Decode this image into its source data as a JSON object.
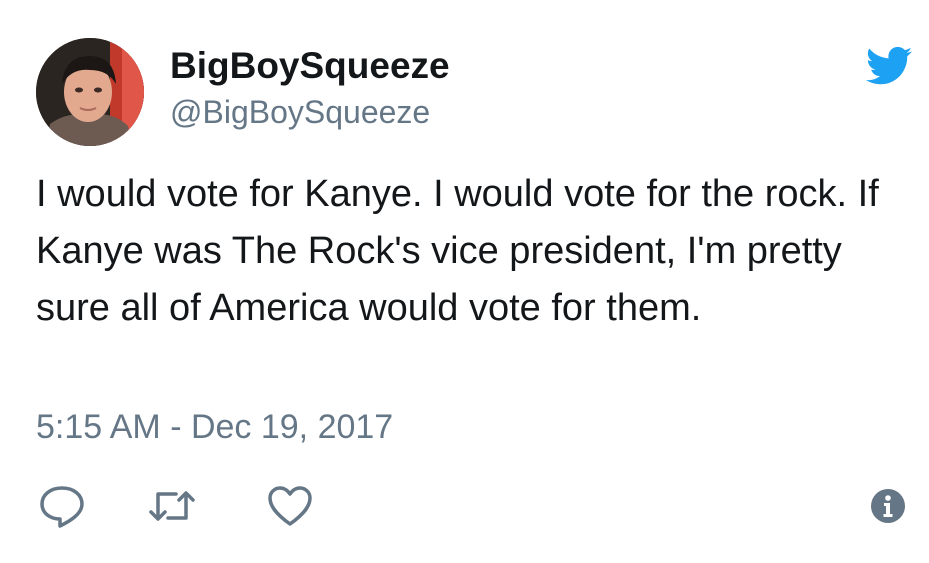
{
  "user": {
    "display_name": "BigBoySqueeze",
    "handle": "@BigBoySqueeze",
    "avatar_icon": "profile-photo"
  },
  "brand": {
    "logo_icon": "twitter-bird-icon",
    "accent_color": "#1da1f2"
  },
  "tweet": {
    "text": "I would vote for Kanye. I would vote for the rock. If Kanye was The Rock's vice president, I'm pretty sure all of America would vote for them.",
    "timestamp": "5:15 AM - Dec 19, 2017"
  },
  "actions": {
    "reply_icon": "reply-icon",
    "retweet_icon": "retweet-icon",
    "like_icon": "heart-icon",
    "info_icon": "info-icon",
    "icon_color": "#657786"
  }
}
